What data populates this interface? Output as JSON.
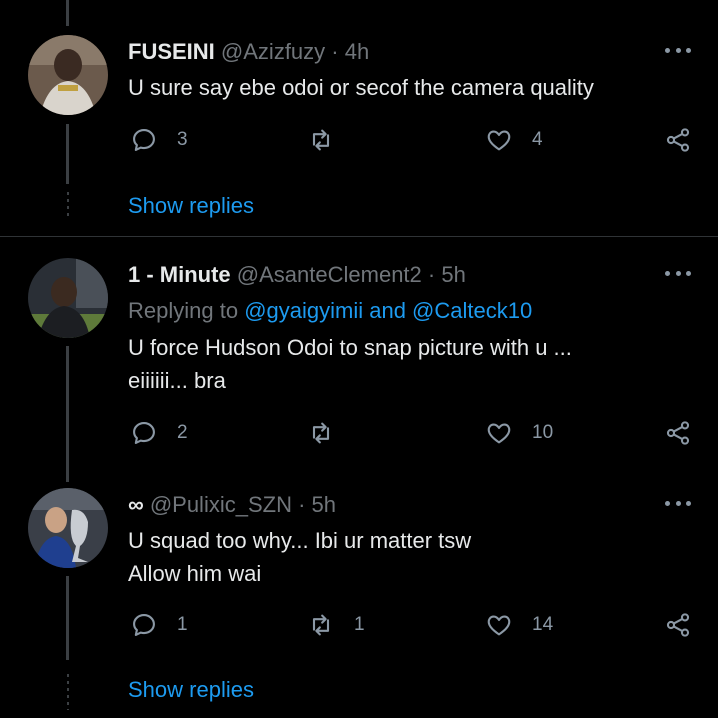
{
  "tweets": [
    {
      "name": "FUSEINI",
      "handle": "@Azizfuzy",
      "time": "· 4h",
      "text": "U sure say ebe odoi or secof the camera quality",
      "replies": "3",
      "retweets": "",
      "likes": "4"
    },
    {
      "name": "1 - Minute",
      "handle": "@AsanteClement2",
      "time": "· 5h",
      "replying_prefix": "Replying to",
      "replying_mentions": "@gyaigyimii and @Calteck10",
      "text_line1": "U force Hudson Odoi to snap picture with u ...",
      "text_line2": "eiiiiii... bra",
      "replies": "2",
      "retweets": "",
      "likes": "10"
    },
    {
      "name": "∞",
      "handle": "@Pulixic_SZN",
      "time": "· 5h",
      "text_line1": "U squad too why... Ibi ur matter tsw",
      "text_line2": "Allow him wai",
      "replies": "1",
      "retweets": "1",
      "likes": "14"
    }
  ],
  "show_replies_label": "Show replies",
  "icons": {
    "reply": "reply-icon",
    "retweet": "retweet-icon",
    "like": "heart-icon",
    "share": "share-icon",
    "more": "more-icon"
  },
  "colors": {
    "accent": "#1d9bf0",
    "muted": "#71767b",
    "background": "#000000"
  }
}
